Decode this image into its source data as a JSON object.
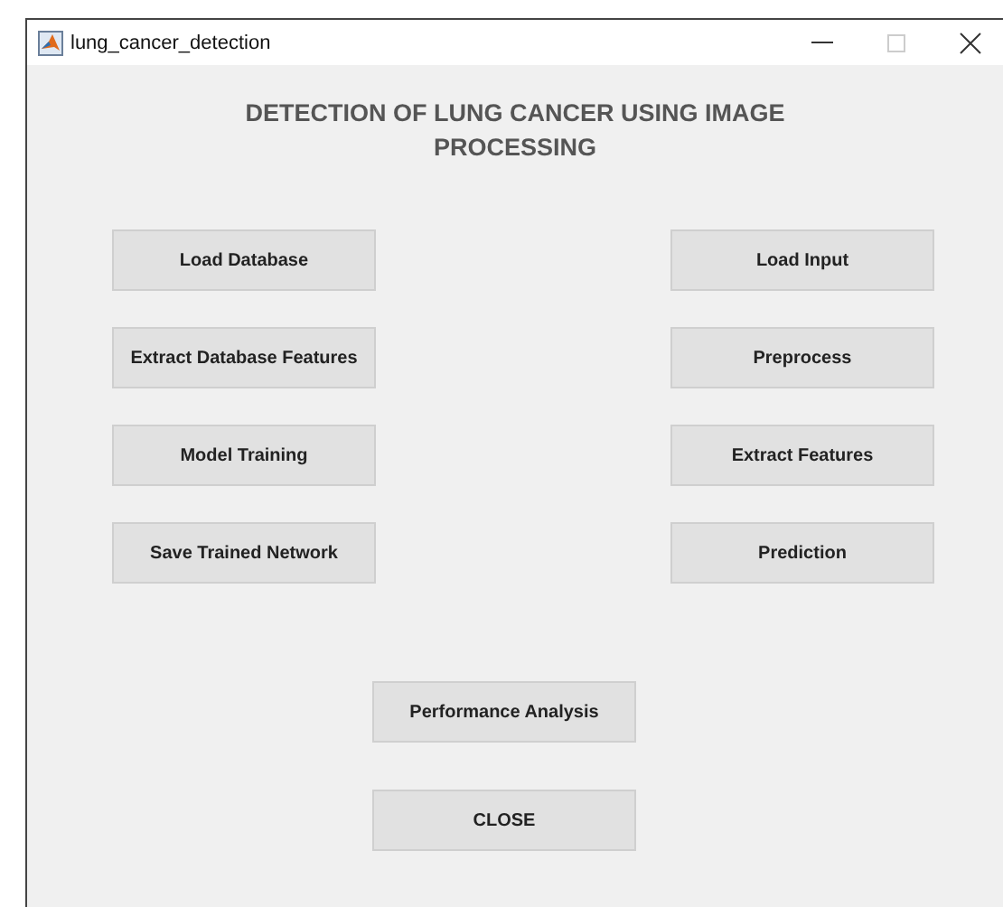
{
  "window": {
    "title": "lung_cancer_detection"
  },
  "heading": "DETECTION OF LUNG CANCER USING IMAGE PROCESSING",
  "left_buttons": [
    "Load Database",
    "Extract Database Features",
    "Model Training",
    "Save Trained Network"
  ],
  "right_buttons": [
    "Load Input",
    "Preprocess",
    "Extract Features",
    "Prediction"
  ],
  "bottom_buttons": [
    "Performance Analysis",
    "CLOSE"
  ]
}
